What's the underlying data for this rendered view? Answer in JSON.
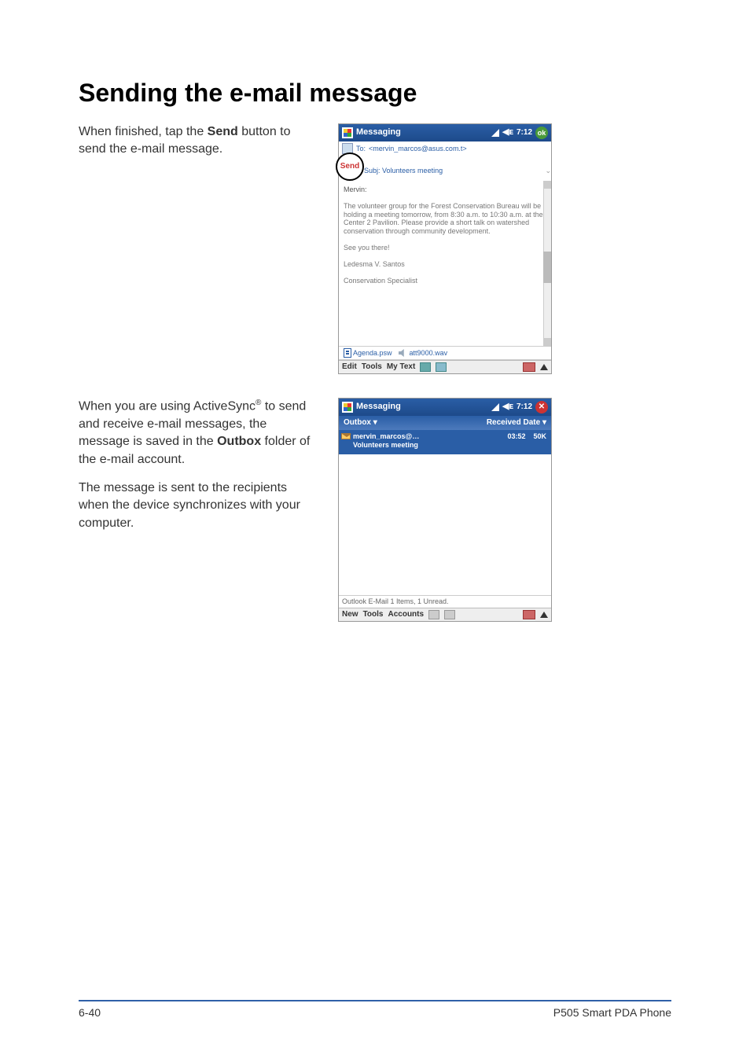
{
  "heading": "Sending the e-mail message",
  "para1_pre": "When finished, tap the ",
  "para1_bold": "Send",
  "para1_post": " button to send the e-mail message.",
  "para2_pre": "When you are using ActiveSync",
  "para2_sup": "®",
  "para2_mid": " to send and receive e-mail messages, the message is saved in the ",
  "para2_bold": "Outbox",
  "para2_post": " folder of the e-mail account.",
  "para3": "The message is sent to the recipients when the device synchronizes with your computer.",
  "shot1": {
    "title": "Messaging",
    "status_time": "7:12",
    "ok": "ok",
    "to_label": "To:",
    "to_value": "<mervin_marcos@asus.com.t>",
    "send": "Send",
    "subj_label": "Subj:",
    "subj_value": "Volunteers meeting",
    "greet": "Mervin:",
    "body": "The volunteer group for the Forest Conservation Bureau will be holding a meeting tomorrow, from 8:30 a.m. to 10:30 a.m. at the Center 2 Pavilion. Please provide a short talk on watershed conservation through community development.",
    "closing": "See you there!",
    "sig1": "Ledesma V. Santos",
    "sig2": "Conservation Specialist",
    "att1": "Agenda.psw",
    "att2": "att9000.wav",
    "menu_edit": "Edit",
    "menu_tools": "Tools",
    "menu_mytext": "My Text"
  },
  "shot2": {
    "title": "Messaging",
    "status_time": "7:12",
    "folder": "Outbox",
    "sort": "Received Date",
    "item_from": "mervin_marcos@…",
    "item_time": "03:52",
    "item_size": "50K",
    "item_subject": "Volunteers meeting",
    "status_line": "Outlook E-Mail  1 Items, 1 Unread.",
    "menu_new": "New",
    "menu_tools": "Tools",
    "menu_accounts": "Accounts"
  },
  "footer": {
    "page": "6-40",
    "product": "P505 Smart PDA Phone"
  }
}
